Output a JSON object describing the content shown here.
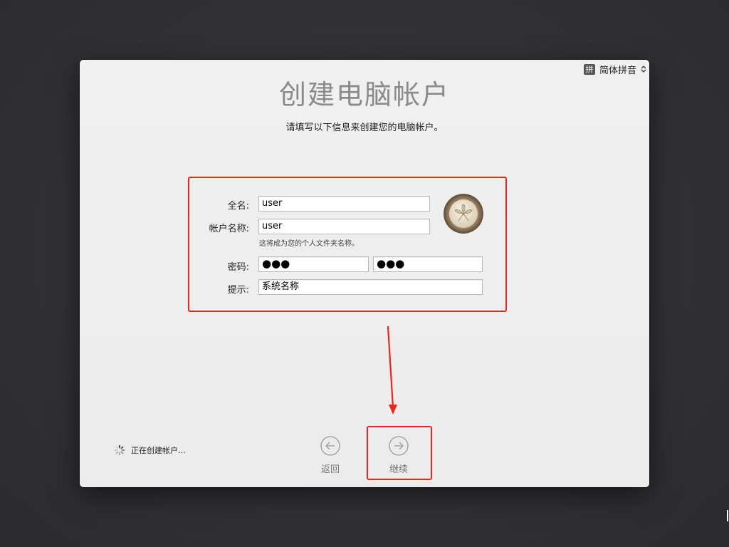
{
  "input_method": {
    "badge": "拼",
    "label": "简体拼音"
  },
  "page": {
    "title": "创建电脑帐户",
    "subtitle": "请填写以下信息来创建您的电脑帐户。"
  },
  "form": {
    "full_name_label": "全名:",
    "full_name_value": "user",
    "account_name_label": "帐户名称:",
    "account_name_value": "user",
    "account_name_note": "这将成为您的个人文件夹名称。",
    "password_label": "密码:",
    "password_value": "●●●",
    "verify_value": "●●●",
    "hint_label": "提示:",
    "hint_value": "系统名称"
  },
  "footer": {
    "status_text": "正在创建帐户…",
    "back_label": "返回",
    "continue_label": "继续"
  },
  "colors": {
    "annotation_red": "#e8271f",
    "panel_bg": "#eeeeee",
    "desktop_bg": "#333337"
  },
  "icons": {
    "input_badge": "pinyin-badge-icon",
    "selector": "up-down-chevron-icon",
    "avatar": "sand-dollar-avatar",
    "back": "back-arrow-circle-icon",
    "continue": "forward-arrow-circle-icon",
    "status": "spinner-icon"
  }
}
